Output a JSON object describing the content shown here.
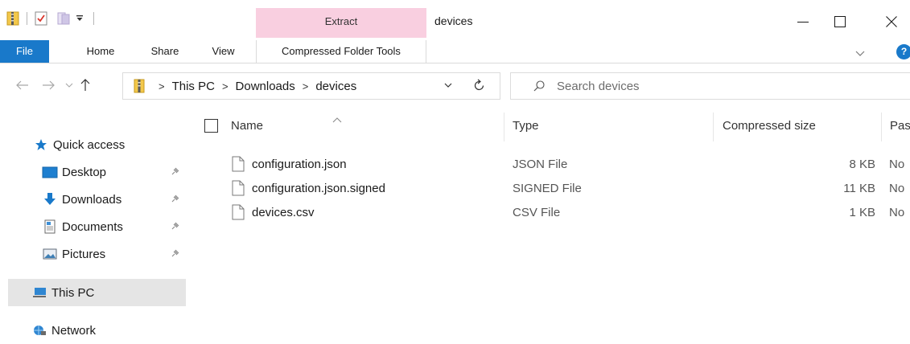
{
  "window": {
    "context_tab_header": "Extract",
    "title": "devices"
  },
  "ribbon": {
    "tabs": [
      {
        "label": "File"
      },
      {
        "label": "Home"
      },
      {
        "label": "Share"
      },
      {
        "label": "View"
      },
      {
        "label": "Compressed Folder Tools"
      }
    ],
    "help_label": "?"
  },
  "address": {
    "breadcrumbs": [
      "This PC",
      "Downloads",
      "devices"
    ]
  },
  "search": {
    "placeholder": "Search devices"
  },
  "nav": {
    "quick_access": "Quick access",
    "items": [
      {
        "label": "Desktop",
        "icon": "desktop-icon",
        "pinned": true
      },
      {
        "label": "Downloads",
        "icon": "download-arrow-icon",
        "pinned": true
      },
      {
        "label": "Documents",
        "icon": "documents-icon",
        "pinned": true
      },
      {
        "label": "Pictures",
        "icon": "pictures-icon",
        "pinned": true
      }
    ],
    "this_pc": "This PC",
    "network": "Network"
  },
  "columns": {
    "name": "Name",
    "type": "Type",
    "compressed_size": "Compressed size",
    "password": "Pas"
  },
  "files": [
    {
      "name": "configuration.json",
      "type": "JSON File",
      "size": "8 KB",
      "password": "No"
    },
    {
      "name": "configuration.json.signed",
      "type": "SIGNED File",
      "size": "11 KB",
      "password": "No"
    },
    {
      "name": "devices.csv",
      "type": "CSV File",
      "size": "1 KB",
      "password": "No"
    }
  ],
  "colors": {
    "accent": "#1979ca",
    "context_tab": "#f9cfe0",
    "selection": "#e5e5e5"
  }
}
